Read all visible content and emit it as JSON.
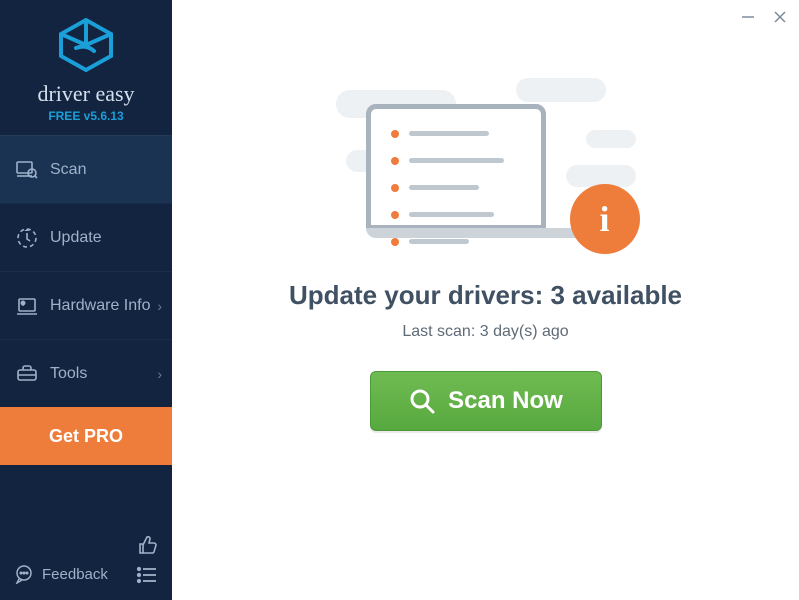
{
  "brand": {
    "name": "driver easy",
    "version_label": "FREE v5.6.13"
  },
  "sidebar": {
    "items": [
      {
        "label": "Scan"
      },
      {
        "label": "Update"
      },
      {
        "label": "Hardware Info"
      },
      {
        "label": "Tools"
      }
    ],
    "get_pro": "Get PRO",
    "feedback": "Feedback"
  },
  "main": {
    "headline": "Update your drivers: 3 available",
    "subline": "Last scan: 3 day(s) ago",
    "scan_button": "Scan Now"
  }
}
